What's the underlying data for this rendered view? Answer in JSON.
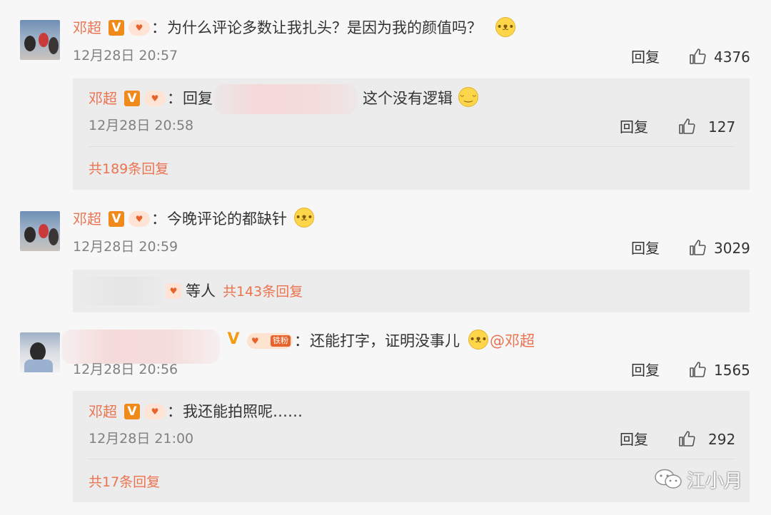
{
  "comments": [
    {
      "user": "邓超",
      "text": "为什么评论多数让我扎头？是因为我的颜值吗？",
      "time": "12月28日 20:57",
      "reply_label": "回复",
      "likes": "4376",
      "reply": {
        "user": "邓超",
        "prefix": "回复",
        "text": "这个没有逻辑",
        "time": "12月28日 20:58",
        "reply_label": "回复",
        "likes": "127"
      },
      "more": "共189条回复"
    },
    {
      "user": "邓超",
      "text": "今晚评论的都缺针",
      "time": "12月28日 20:59",
      "reply_label": "回复",
      "likes": "3029",
      "more_text": "等人",
      "more": "共143条回复"
    },
    {
      "user": "",
      "fan_tag": "铁粉",
      "text": "还能打字，证明没事儿",
      "mention": "@邓超",
      "time": "12月28日 20:56",
      "reply_label": "回复",
      "likes": "1565",
      "reply": {
        "user": "邓超",
        "text": "我还能拍照呢……",
        "time": "12月28日 21:00",
        "reply_label": "回复",
        "likes": "292"
      },
      "more": "共17条回复"
    }
  ],
  "badges": {
    "verified": "V",
    "colon": "："
  },
  "watermark": {
    "text": "江小月",
    "icon": "wechat-icon"
  },
  "colors": {
    "accent": "#eb7350",
    "verified": "#f08a1a",
    "background": "#f7f7f7"
  },
  "icons": {
    "like": "thumbs-up-icon",
    "emoji": "doge-emoji-icon"
  }
}
